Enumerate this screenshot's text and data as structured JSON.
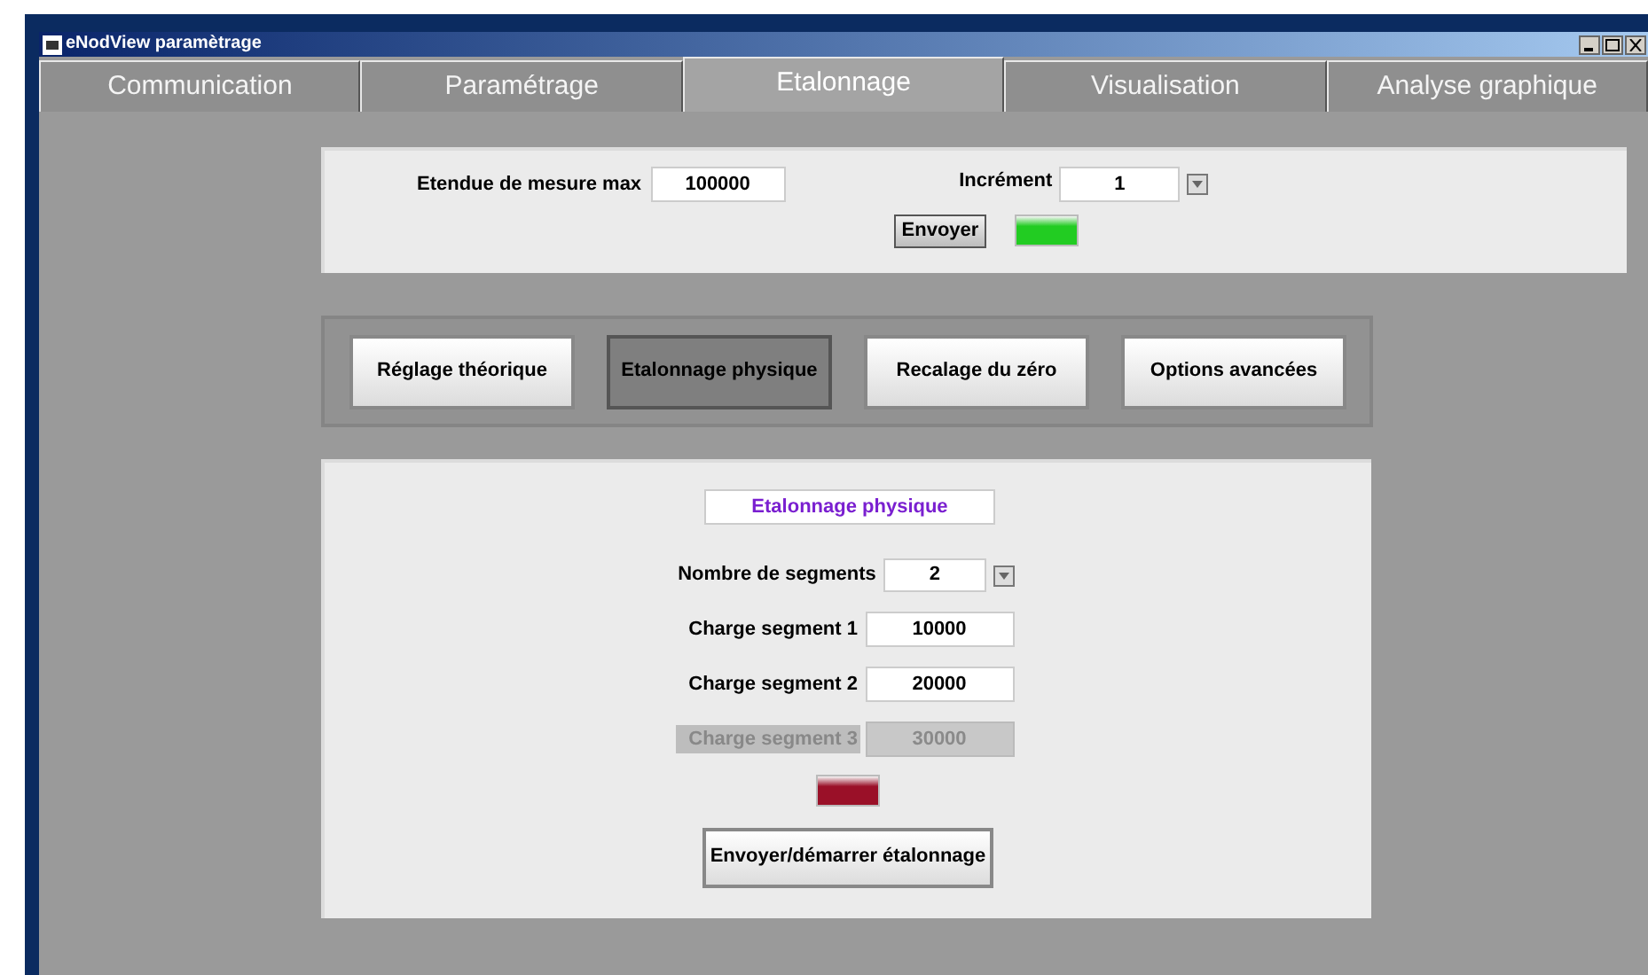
{
  "window": {
    "title": "eNodView paramètrage"
  },
  "tabs": [
    {
      "label": "Communication",
      "selected": false
    },
    {
      "label": "Paramétrage",
      "selected": false
    },
    {
      "label": "Etalonnage",
      "selected": true
    },
    {
      "label": "Visualisation",
      "selected": false
    },
    {
      "label": "Analyse graphique",
      "selected": false
    }
  ],
  "range": {
    "label": "Etendue de mesure max",
    "value": "100000"
  },
  "increment": {
    "label": "Incrément",
    "value": "1"
  },
  "send_button": "Envoyer",
  "send_led": {
    "on": true,
    "color": "#22cc22"
  },
  "modes": [
    {
      "label": "Réglage théorique",
      "selected": false
    },
    {
      "label": "Etalonnage physique",
      "selected": true
    },
    {
      "label": "Recalage du zéro",
      "selected": false
    },
    {
      "label": "Options avancées",
      "selected": false
    }
  ],
  "calibration": {
    "title": "Etalonnage physique",
    "segments": {
      "label": "Nombre de segments",
      "value": "2"
    },
    "loads": [
      {
        "label": "Charge  segment 1",
        "value": "10000",
        "disabled": false
      },
      {
        "label": "Charge  segment 2",
        "value": "20000",
        "disabled": false
      },
      {
        "label": "Charge segment 3",
        "value": "30000",
        "disabled": true
      }
    ],
    "led": {
      "on": true,
      "color": "#9a1028"
    },
    "start_button": "Envoyer/démarrer étalonnage"
  }
}
